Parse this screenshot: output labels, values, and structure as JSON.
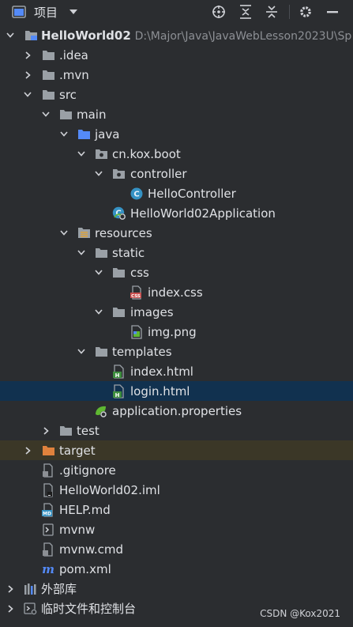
{
  "toolbar": {
    "title": "项目",
    "icons": [
      "project-view-icon",
      "locate-icon",
      "expand-all-icon",
      "collapse-all-icon",
      "settings-icon",
      "hide-icon"
    ]
  },
  "tree": {
    "root_name": "HelloWorld02",
    "root_path": "D:\\Major\\Java\\JavaWebLesson2023U\\Sp",
    "idea": ".idea",
    "mvn": ".mvn",
    "src": "src",
    "main": "main",
    "java": "java",
    "package": "cn.kox.boot",
    "controller": "controller",
    "hello_controller": "HelloController",
    "application_class": "HelloWorld02Application",
    "resources": "resources",
    "static": "static",
    "css": "css",
    "index_css": "index.css",
    "images": "images",
    "img_png": "img.png",
    "templates": "templates",
    "index_html": "index.html",
    "login_html": "login.html",
    "application_properties": "application.properties",
    "test": "test",
    "target": "target",
    "gitignore": ".gitignore",
    "iml": "HelloWorld02.iml",
    "help_md": "HELP.md",
    "mvnw": "mvnw",
    "mvnw_cmd": "mvnw.cmd",
    "pom": "pom.xml",
    "external_libs": "外部库",
    "scratches": "临时文件和控制台"
  },
  "colors": {
    "selection": "#11314f",
    "target_row": "#3b3727",
    "folder_source": "#548af7",
    "folder_excluded": "#e0823d",
    "folder_plain": "#9aa0a6"
  },
  "watermark": "CSDN @Kox2021"
}
